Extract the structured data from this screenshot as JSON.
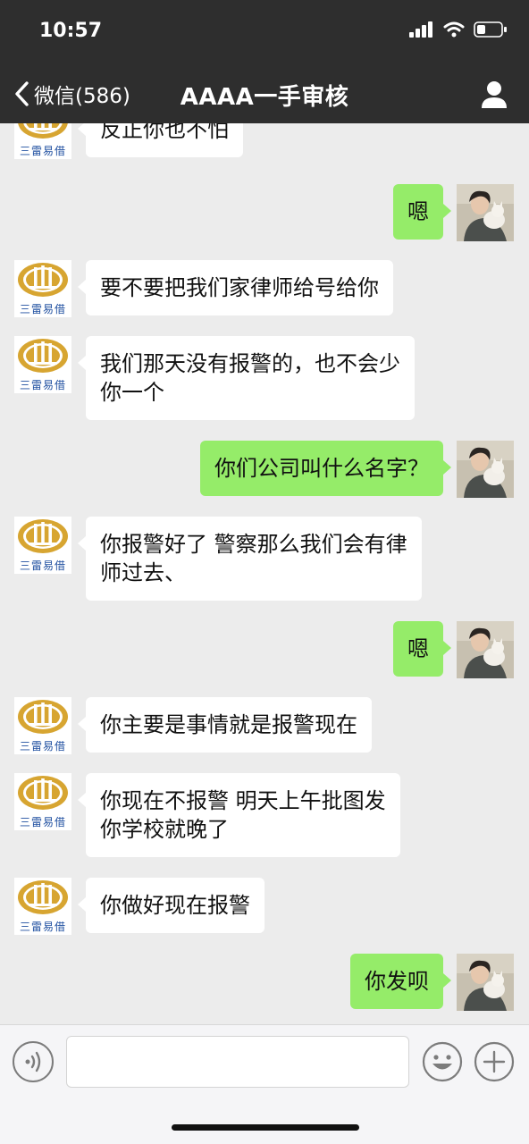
{
  "status_bar": {
    "time": "10:57"
  },
  "nav": {
    "back_label": "微信(586)",
    "title": "AAAA一手审核"
  },
  "logo_caption": "三雷易借",
  "messages": [
    {
      "side": "in",
      "lines": [
        "反正你也不怕"
      ]
    },
    {
      "side": "out",
      "lines": [
        "嗯"
      ]
    },
    {
      "side": "in",
      "lines": [
        "要不要把我们家律师给号给你"
      ]
    },
    {
      "side": "in",
      "lines": [
        "我们那天没有报警的，也不会少",
        "你一个"
      ]
    },
    {
      "side": "out",
      "lines": [
        "你们公司叫什么名字？"
      ]
    },
    {
      "side": "in",
      "lines": [
        "你报警好了  警察那么我们会有律",
        "师过去、"
      ]
    },
    {
      "side": "out",
      "lines": [
        "嗯"
      ]
    },
    {
      "side": "in",
      "lines": [
        "你主要是事情就是报警现在"
      ]
    },
    {
      "side": "in",
      "lines": [
        "你现在不报警   明天上午批图发",
        "你学校就晚了"
      ]
    },
    {
      "side": "in",
      "lines": [
        "你做好现在报警"
      ]
    },
    {
      "side": "out",
      "lines": [
        "你发呗"
      ]
    }
  ],
  "input": {
    "value": ""
  },
  "colors": {
    "nav_bg": "#2e2e2e",
    "chat_bg": "#ececec",
    "bubble_out": "#95ec69",
    "bubble_in": "#ffffff",
    "logo_gold": "#d7a531",
    "logo_blue": "#1f4fa0"
  },
  "icons": [
    "chevron-left-icon",
    "signal-icon",
    "wifi-icon",
    "battery-icon",
    "profile-icon",
    "voice-icon",
    "emoji-icon",
    "plus-icon"
  ]
}
